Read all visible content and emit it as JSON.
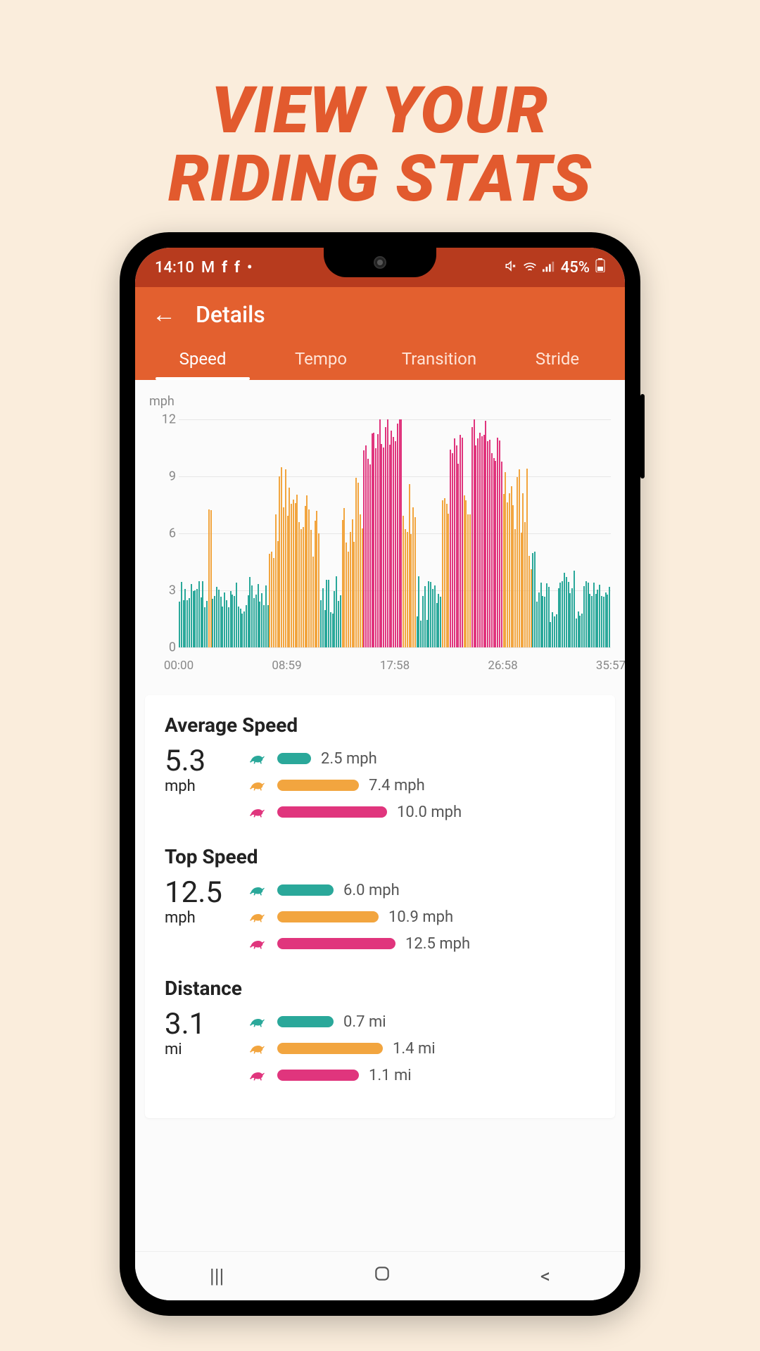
{
  "hero": {
    "line1": "VIEW YOUR",
    "line2": "RIDING STATS"
  },
  "status": {
    "time": "14:10",
    "battery": "45%"
  },
  "header": {
    "title": "Details"
  },
  "tabs": [
    {
      "label": "Speed",
      "active": true
    },
    {
      "label": "Tempo",
      "active": false
    },
    {
      "label": "Transition",
      "active": false
    },
    {
      "label": "Stride",
      "active": false
    }
  ],
  "colors": {
    "teal": "#2aa89a",
    "orange": "#f2a53f",
    "pink": "#e0357d"
  },
  "chart_data": {
    "type": "bar",
    "ylabel": "mph",
    "ylim": [
      0,
      12
    ],
    "yticks": [
      0,
      3,
      6,
      9,
      12
    ],
    "xticks": [
      "00:00",
      "08:59",
      "17:58",
      "26:58",
      "35:57"
    ],
    "segments": [
      {
        "range": [
          0.0,
          0.06
        ],
        "gait": "teal",
        "avg": 3.0,
        "spread": 0.6
      },
      {
        "range": [
          0.06,
          0.07
        ],
        "gait": "teal",
        "avg": 2.2,
        "spread": 0.3
      },
      {
        "range": [
          0.07,
          0.08
        ],
        "gait": "orange",
        "avg": 6.0,
        "spread": 2.0
      },
      {
        "range": [
          0.08,
          0.1
        ],
        "gait": "teal",
        "avg": 3.0,
        "spread": 0.6
      },
      {
        "range": [
          0.1,
          0.12
        ],
        "gait": "teal",
        "avg": 2.4,
        "spread": 0.5
      },
      {
        "range": [
          0.12,
          0.14
        ],
        "gait": "teal",
        "avg": 3.2,
        "spread": 0.6
      },
      {
        "range": [
          0.14,
          0.16
        ],
        "gait": "teal",
        "avg": 2.0,
        "spread": 0.8
      },
      {
        "range": [
          0.16,
          0.18
        ],
        "gait": "teal",
        "avg": 3.2,
        "spread": 0.6
      },
      {
        "range": [
          0.18,
          0.21
        ],
        "gait": "teal",
        "avg": 2.8,
        "spread": 0.6
      },
      {
        "range": [
          0.21,
          0.24
        ],
        "gait": "orange",
        "avg": 7.0,
        "spread": 2.5
      },
      {
        "range": [
          0.24,
          0.26
        ],
        "gait": "orange",
        "avg": 8.2,
        "spread": 1.5
      },
      {
        "range": [
          0.26,
          0.31
        ],
        "gait": "orange",
        "avg": 7.4,
        "spread": 1.8
      },
      {
        "range": [
          0.31,
          0.33
        ],
        "gait": "orange",
        "avg": 6.0,
        "spread": 2.0
      },
      {
        "range": [
          0.33,
          0.36
        ],
        "gait": "teal",
        "avg": 2.6,
        "spread": 1.0
      },
      {
        "range": [
          0.36,
          0.38
        ],
        "gait": "teal",
        "avg": 3.0,
        "spread": 0.8
      },
      {
        "range": [
          0.38,
          0.41
        ],
        "gait": "orange",
        "avg": 6.5,
        "spread": 1.5
      },
      {
        "range": [
          0.41,
          0.43
        ],
        "gait": "orange",
        "avg": 7.5,
        "spread": 1.5
      },
      {
        "range": [
          0.43,
          0.46
        ],
        "gait": "pink",
        "avg": 11.0,
        "spread": 1.4
      },
      {
        "range": [
          0.46,
          0.52
        ],
        "gait": "pink",
        "avg": 11.4,
        "spread": 1.2
      },
      {
        "range": [
          0.52,
          0.55
        ],
        "gait": "orange",
        "avg": 7.2,
        "spread": 1.5
      },
      {
        "range": [
          0.55,
          0.59
        ],
        "gait": "teal",
        "avg": 2.8,
        "spread": 1.5
      },
      {
        "range": [
          0.59,
          0.61
        ],
        "gait": "teal",
        "avg": 3.0,
        "spread": 0.8
      },
      {
        "range": [
          0.61,
          0.63
        ],
        "gait": "orange",
        "avg": 7.0,
        "spread": 1.0
      },
      {
        "range": [
          0.63,
          0.66
        ],
        "gait": "pink",
        "avg": 10.8,
        "spread": 1.2
      },
      {
        "range": [
          0.66,
          0.68
        ],
        "gait": "orange",
        "avg": 7.0,
        "spread": 1.0
      },
      {
        "range": [
          0.68,
          0.72
        ],
        "gait": "pink",
        "avg": 11.2,
        "spread": 1.0
      },
      {
        "range": [
          0.72,
          0.75
        ],
        "gait": "pink",
        "avg": 10.6,
        "spread": 1.0
      },
      {
        "range": [
          0.75,
          0.81
        ],
        "gait": "orange",
        "avg": 7.6,
        "spread": 1.8
      },
      {
        "range": [
          0.81,
          0.82
        ],
        "gait": "orange",
        "avg": 5.0,
        "spread": 1.0
      },
      {
        "range": [
          0.82,
          0.84
        ],
        "gait": "teal",
        "avg": 4.0,
        "spread": 2.0
      },
      {
        "range": [
          0.84,
          0.86
        ],
        "gait": "teal",
        "avg": 3.0,
        "spread": 0.6
      },
      {
        "range": [
          0.86,
          0.88
        ],
        "gait": "teal",
        "avg": 1.6,
        "spread": 0.7
      },
      {
        "range": [
          0.88,
          0.92
        ],
        "gait": "teal",
        "avg": 3.4,
        "spread": 0.7
      },
      {
        "range": [
          0.92,
          0.94
        ],
        "gait": "teal",
        "avg": 1.6,
        "spread": 0.5
      },
      {
        "range": [
          0.94,
          1.0
        ],
        "gait": "teal",
        "avg": 3.2,
        "spread": 0.6
      }
    ]
  },
  "stats": [
    {
      "title": "Average Speed",
      "value": "5.3",
      "unit": "mph",
      "bars": [
        {
          "gait": "teal",
          "label": "2.5 mph",
          "frac": 0.24
        },
        {
          "gait": "orange",
          "label": "7.4 mph",
          "frac": 0.58
        },
        {
          "gait": "pink",
          "label": "10.0 mph",
          "frac": 0.78
        }
      ]
    },
    {
      "title": "Top Speed",
      "value": "12.5",
      "unit": "mph",
      "bars": [
        {
          "gait": "teal",
          "label": "6.0 mph",
          "frac": 0.4
        },
        {
          "gait": "orange",
          "label": "10.9 mph",
          "frac": 0.72
        },
        {
          "gait": "pink",
          "label": "12.5 mph",
          "frac": 0.84
        }
      ]
    },
    {
      "title": "Distance",
      "value": "3.1",
      "unit": "mi",
      "bars": [
        {
          "gait": "teal",
          "label": "0.7 mi",
          "frac": 0.4
        },
        {
          "gait": "orange",
          "label": "1.4 mi",
          "frac": 0.75
        },
        {
          "gait": "pink",
          "label": "1.1 mi",
          "frac": 0.58
        }
      ]
    }
  ]
}
